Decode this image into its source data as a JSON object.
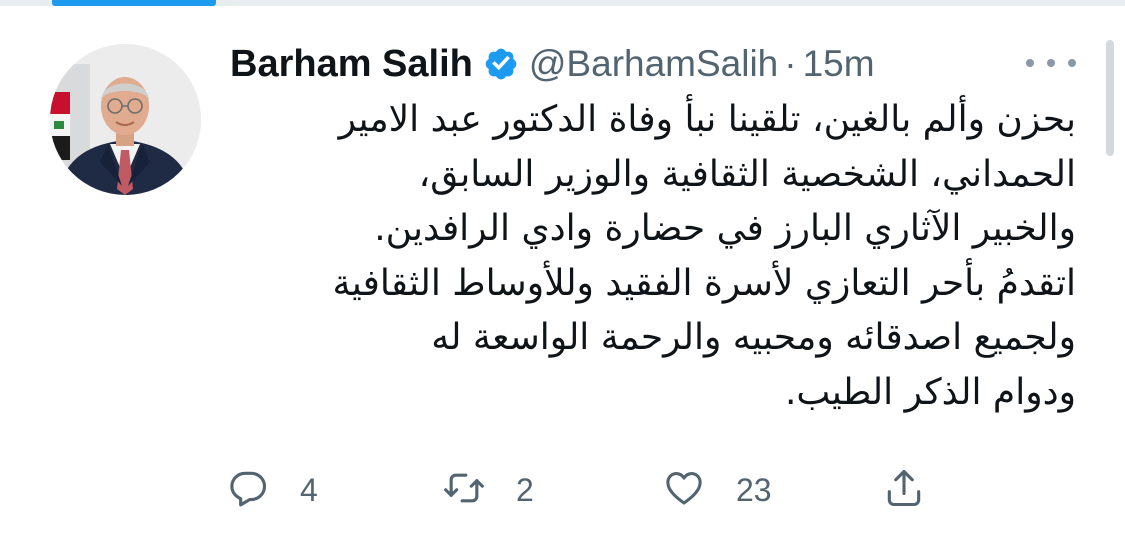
{
  "tweet": {
    "author_name": "Barham Salih",
    "handle": "@BarhamSalih",
    "separator": "·",
    "time": "15m",
    "verified": true,
    "text": "بحزن وألم بالغين، تلقينا نبأ وفاة الدكتور عبد الامير\nالحمداني، الشخصية الثقافية والوزير السابق،\nوالخبير الآثاري البارز في حضارة وادي الرافدين.\nاتقدمُ بأحر التعازي لأسرة الفقيد وللأوساط الثقافية\nولجميع اصدقائه ومحبيه والرحمة الواسعة له\nودوام الذكر الطيب."
  },
  "actions": {
    "replies": "4",
    "retweets": "2",
    "likes": "23"
  },
  "icons": {
    "verified": "verified-badge-icon",
    "reply": "speech-bubble-icon",
    "retweet": "retweet-icon",
    "like": "heart-icon",
    "share": "share-upload-icon",
    "more": "more-dots-icon"
  },
  "colors": {
    "accent": "#1d9bf0",
    "text": "#0f1419",
    "muted": "#536471"
  }
}
